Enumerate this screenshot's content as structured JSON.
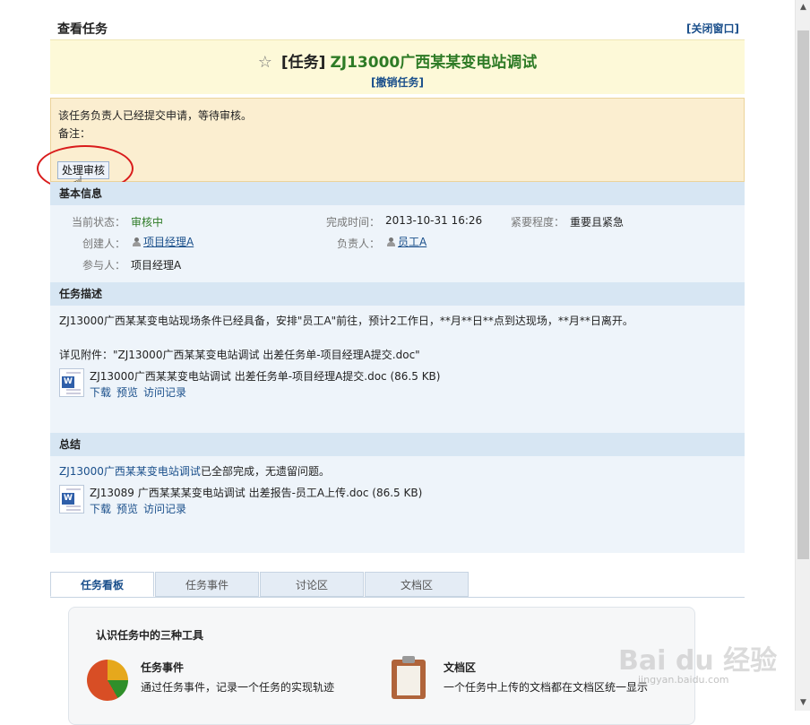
{
  "header": {
    "title": "查看任务",
    "close_link": "[关闭窗口]"
  },
  "task": {
    "tag": "[任务]",
    "name": "ZJ13000广西某某变电站调试",
    "revoke_link": "[撤销任务]"
  },
  "notice": {
    "message": "该任务负责人已经提交申请，等待审核。",
    "remark": "备注：",
    "review_button": "处理审核"
  },
  "basic_info": {
    "heading": "基本信息",
    "status_label": "当前状态：",
    "status_value": "审核中",
    "done_time_label": "完成时间：",
    "done_time_value": "2013-10-31 16:26",
    "urgency_label": "紧要程度：",
    "urgency_value": "重要且紧急",
    "creator_label": "创建人：",
    "creator_value": "项目经理A",
    "owner_label": "负责人：",
    "owner_value": "员工A",
    "participants_label": "参与人：",
    "participants_value": "项目经理A"
  },
  "description": {
    "heading": "任务描述",
    "text": "ZJ13000广西某某变电站现场条件已经具备，安排\"员工A\"前往，预计2工作日，**月**日**点到达现场，**月**日离开。",
    "attachment_line": "详见附件：\"ZJ13000广西某某变电站调试 出差任务单-项目经理A提交.doc\"",
    "file": {
      "name": "ZJ13000广西某某变电站调试 出差任务单-项目经理A提交.doc (86.5 KB)",
      "download": "下载",
      "preview": "预览",
      "history": "访问记录"
    }
  },
  "summary": {
    "heading": "总结",
    "text_link": "ZJ13000广西某某变电站调试",
    "text_rest": "已全部完成，无遗留问题。",
    "file": {
      "name": "ZJ13089 广西某某某变电站调试 出差报告-员工A上传.doc (86.5 KB)",
      "download": "下载",
      "preview": "预览",
      "history": "访问记录"
    }
  },
  "tabs": [
    "任务看板",
    "任务事件",
    "讨论区",
    "文档区"
  ],
  "active_tab": "任务看板",
  "panel": {
    "title": "认识任务中的三种工具",
    "tools": [
      {
        "name": "任务事件",
        "desc": "通过任务事件，记录一个任务的实现轨迹",
        "icon": "pie-chart-icon"
      },
      {
        "name": "文档区",
        "desc": "一个任务中上传的文档都在文档区统一显示",
        "icon": "clipboard-icon"
      }
    ]
  },
  "watermark": {
    "text": "Bai du 经验",
    "sub": "jingyan.baidu.com"
  },
  "colors": {
    "accent": "#1a4f8b",
    "green": "#2e7b26",
    "header_bg": "#fdf9d8",
    "notice_bg": "#fbeed0",
    "section_bg": "#eef4fa",
    "annotation": "#d91c1c"
  }
}
